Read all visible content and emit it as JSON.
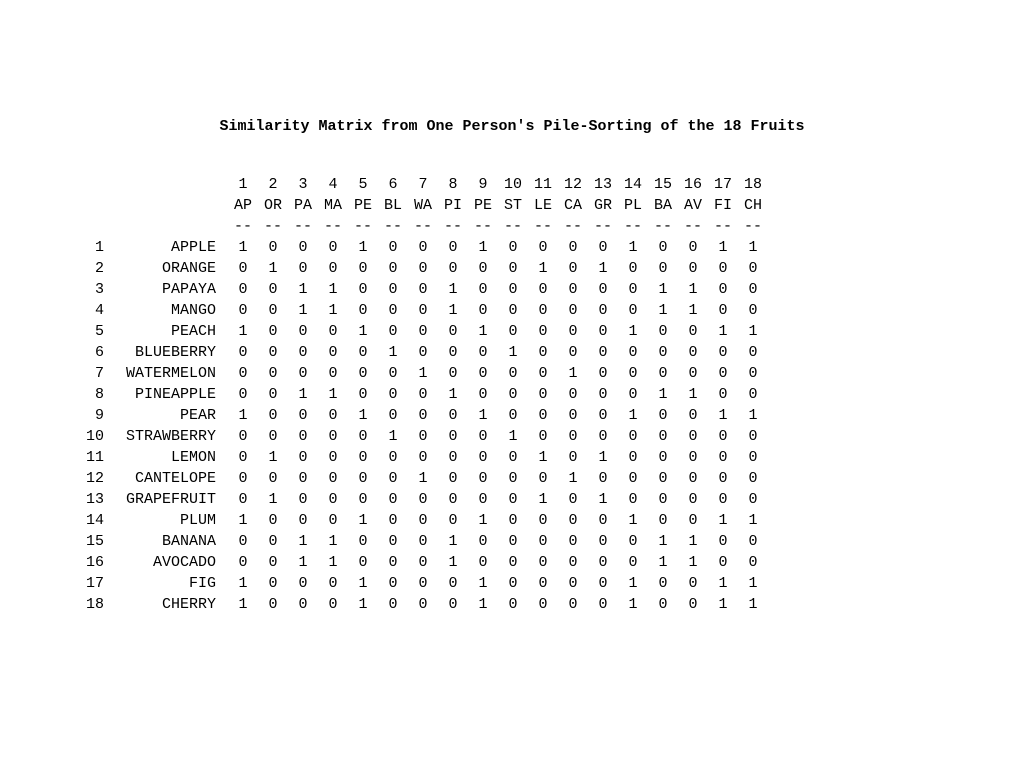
{
  "title": "Similarity Matrix from One Person's Pile-Sorting of the 18 Fruits",
  "col_numbers": [
    "1",
    "2",
    "3",
    "4",
    "5",
    "6",
    "7",
    "8",
    "9",
    "10",
    "11",
    "12",
    "13",
    "14",
    "15",
    "16",
    "17",
    "18"
  ],
  "col_abbrs": [
    "AP",
    "OR",
    "PA",
    "MA",
    "PE",
    "BL",
    "WA",
    "PI",
    "PE",
    "ST",
    "LE",
    "CA",
    "GR",
    "PL",
    "BA",
    "AV",
    "FI",
    "CH"
  ],
  "dash": "--",
  "rows": [
    {
      "idx": "1",
      "name": "APPLE",
      "v": [
        "1",
        "0",
        "0",
        "0",
        "1",
        "0",
        "0",
        "0",
        "1",
        "0",
        "0",
        "0",
        "0",
        "1",
        "0",
        "0",
        "1",
        "1"
      ]
    },
    {
      "idx": "2",
      "name": "ORANGE",
      "v": [
        "0",
        "1",
        "0",
        "0",
        "0",
        "0",
        "0",
        "0",
        "0",
        "0",
        "1",
        "0",
        "1",
        "0",
        "0",
        "0",
        "0",
        "0"
      ]
    },
    {
      "idx": "3",
      "name": "PAPAYA",
      "v": [
        "0",
        "0",
        "1",
        "1",
        "0",
        "0",
        "0",
        "1",
        "0",
        "0",
        "0",
        "0",
        "0",
        "0",
        "1",
        "1",
        "0",
        "0"
      ]
    },
    {
      "idx": "4",
      "name": "MANGO",
      "v": [
        "0",
        "0",
        "1",
        "1",
        "0",
        "0",
        "0",
        "1",
        "0",
        "0",
        "0",
        "0",
        "0",
        "0",
        "1",
        "1",
        "0",
        "0"
      ]
    },
    {
      "idx": "5",
      "name": "PEACH",
      "v": [
        "1",
        "0",
        "0",
        "0",
        "1",
        "0",
        "0",
        "0",
        "1",
        "0",
        "0",
        "0",
        "0",
        "1",
        "0",
        "0",
        "1",
        "1"
      ]
    },
    {
      "idx": "6",
      "name": "BLUEBERRY",
      "v": [
        "0",
        "0",
        "0",
        "0",
        "0",
        "1",
        "0",
        "0",
        "0",
        "1",
        "0",
        "0",
        "0",
        "0",
        "0",
        "0",
        "0",
        "0"
      ]
    },
    {
      "idx": "7",
      "name": "WATERMELON",
      "v": [
        "0",
        "0",
        "0",
        "0",
        "0",
        "0",
        "1",
        "0",
        "0",
        "0",
        "0",
        "1",
        "0",
        "0",
        "0",
        "0",
        "0",
        "0"
      ]
    },
    {
      "idx": "8",
      "name": "PINEAPPLE",
      "v": [
        "0",
        "0",
        "1",
        "1",
        "0",
        "0",
        "0",
        "1",
        "0",
        "0",
        "0",
        "0",
        "0",
        "0",
        "1",
        "1",
        "0",
        "0"
      ]
    },
    {
      "idx": "9",
      "name": "PEAR",
      "v": [
        "1",
        "0",
        "0",
        "0",
        "1",
        "0",
        "0",
        "0",
        "1",
        "0",
        "0",
        "0",
        "0",
        "1",
        "0",
        "0",
        "1",
        "1"
      ]
    },
    {
      "idx": "10",
      "name": "STRAWBERRY",
      "v": [
        "0",
        "0",
        "0",
        "0",
        "0",
        "1",
        "0",
        "0",
        "0",
        "1",
        "0",
        "0",
        "0",
        "0",
        "0",
        "0",
        "0",
        "0"
      ]
    },
    {
      "idx": "11",
      "name": "LEMON",
      "v": [
        "0",
        "1",
        "0",
        "0",
        "0",
        "0",
        "0",
        "0",
        "0",
        "0",
        "1",
        "0",
        "1",
        "0",
        "0",
        "0",
        "0",
        "0"
      ]
    },
    {
      "idx": "12",
      "name": "CANTELOPE",
      "v": [
        "0",
        "0",
        "0",
        "0",
        "0",
        "0",
        "1",
        "0",
        "0",
        "0",
        "0",
        "1",
        "0",
        "0",
        "0",
        "0",
        "0",
        "0"
      ]
    },
    {
      "idx": "13",
      "name": "GRAPEFRUIT",
      "v": [
        "0",
        "1",
        "0",
        "0",
        "0",
        "0",
        "0",
        "0",
        "0",
        "0",
        "1",
        "0",
        "1",
        "0",
        "0",
        "0",
        "0",
        "0"
      ]
    },
    {
      "idx": "14",
      "name": "PLUM",
      "v": [
        "1",
        "0",
        "0",
        "0",
        "1",
        "0",
        "0",
        "0",
        "1",
        "0",
        "0",
        "0",
        "0",
        "1",
        "0",
        "0",
        "1",
        "1"
      ]
    },
    {
      "idx": "15",
      "name": "BANANA",
      "v": [
        "0",
        "0",
        "1",
        "1",
        "0",
        "0",
        "0",
        "1",
        "0",
        "0",
        "0",
        "0",
        "0",
        "0",
        "1",
        "1",
        "0",
        "0"
      ]
    },
    {
      "idx": "16",
      "name": "AVOCADO",
      "v": [
        "0",
        "0",
        "1",
        "1",
        "0",
        "0",
        "0",
        "1",
        "0",
        "0",
        "0",
        "0",
        "0",
        "0",
        "1",
        "1",
        "0",
        "0"
      ]
    },
    {
      "idx": "17",
      "name": "FIG",
      "v": [
        "1",
        "0",
        "0",
        "0",
        "1",
        "0",
        "0",
        "0",
        "1",
        "0",
        "0",
        "0",
        "0",
        "1",
        "0",
        "0",
        "1",
        "1"
      ]
    },
    {
      "idx": "18",
      "name": "CHERRY",
      "v": [
        "1",
        "0",
        "0",
        "0",
        "1",
        "0",
        "0",
        "0",
        "1",
        "0",
        "0",
        "0",
        "0",
        "1",
        "0",
        "0",
        "1",
        "1"
      ]
    }
  ],
  "chart_data": {
    "type": "table",
    "title": "Similarity Matrix from One Person's Pile-Sorting of the 18 Fruits",
    "row_labels": [
      "APPLE",
      "ORANGE",
      "PAPAYA",
      "MANGO",
      "PEACH",
      "BLUEBERRY",
      "WATERMELON",
      "PINEAPPLE",
      "PEAR",
      "STRAWBERRY",
      "LEMON",
      "CANTELOPE",
      "GRAPEFRUIT",
      "PLUM",
      "BANANA",
      "AVOCADO",
      "FIG",
      "CHERRY"
    ],
    "col_labels": [
      "AP",
      "OR",
      "PA",
      "MA",
      "PE",
      "BL",
      "WA",
      "PI",
      "PE",
      "ST",
      "LE",
      "CA",
      "GR",
      "PL",
      "BA",
      "AV",
      "FI",
      "CH"
    ],
    "matrix": [
      [
        1,
        0,
        0,
        0,
        1,
        0,
        0,
        0,
        1,
        0,
        0,
        0,
        0,
        1,
        0,
        0,
        1,
        1
      ],
      [
        0,
        1,
        0,
        0,
        0,
        0,
        0,
        0,
        0,
        0,
        1,
        0,
        1,
        0,
        0,
        0,
        0,
        0
      ],
      [
        0,
        0,
        1,
        1,
        0,
        0,
        0,
        1,
        0,
        0,
        0,
        0,
        0,
        0,
        1,
        1,
        0,
        0
      ],
      [
        0,
        0,
        1,
        1,
        0,
        0,
        0,
        1,
        0,
        0,
        0,
        0,
        0,
        0,
        1,
        1,
        0,
        0
      ],
      [
        1,
        0,
        0,
        0,
        1,
        0,
        0,
        0,
        1,
        0,
        0,
        0,
        0,
        1,
        0,
        0,
        1,
        1
      ],
      [
        0,
        0,
        0,
        0,
        0,
        1,
        0,
        0,
        0,
        1,
        0,
        0,
        0,
        0,
        0,
        0,
        0,
        0
      ],
      [
        0,
        0,
        0,
        0,
        0,
        0,
        1,
        0,
        0,
        0,
        0,
        1,
        0,
        0,
        0,
        0,
        0,
        0
      ],
      [
        0,
        0,
        1,
        1,
        0,
        0,
        0,
        1,
        0,
        0,
        0,
        0,
        0,
        0,
        1,
        1,
        0,
        0
      ],
      [
        1,
        0,
        0,
        0,
        1,
        0,
        0,
        0,
        1,
        0,
        0,
        0,
        0,
        1,
        0,
        0,
        1,
        1
      ],
      [
        0,
        0,
        0,
        0,
        0,
        1,
        0,
        0,
        0,
        1,
        0,
        0,
        0,
        0,
        0,
        0,
        0,
        0
      ],
      [
        0,
        1,
        0,
        0,
        0,
        0,
        0,
        0,
        0,
        0,
        1,
        0,
        1,
        0,
        0,
        0,
        0,
        0
      ],
      [
        0,
        0,
        0,
        0,
        0,
        0,
        1,
        0,
        0,
        0,
        0,
        1,
        0,
        0,
        0,
        0,
        0,
        0
      ],
      [
        0,
        1,
        0,
        0,
        0,
        0,
        0,
        0,
        0,
        0,
        1,
        0,
        1,
        0,
        0,
        0,
        0,
        0
      ],
      [
        1,
        0,
        0,
        0,
        1,
        0,
        0,
        0,
        1,
        0,
        0,
        0,
        0,
        1,
        0,
        0,
        1,
        1
      ],
      [
        0,
        0,
        1,
        1,
        0,
        0,
        0,
        1,
        0,
        0,
        0,
        0,
        0,
        0,
        1,
        1,
        0,
        0
      ],
      [
        0,
        0,
        1,
        1,
        0,
        0,
        0,
        1,
        0,
        0,
        0,
        0,
        0,
        0,
        1,
        1,
        0,
        0
      ],
      [
        1,
        0,
        0,
        0,
        1,
        0,
        0,
        0,
        1,
        0,
        0,
        0,
        0,
        1,
        0,
        0,
        1,
        1
      ],
      [
        1,
        0,
        0,
        0,
        1,
        0,
        0,
        0,
        1,
        0,
        0,
        0,
        0,
        1,
        0,
        0,
        1,
        1
      ]
    ]
  }
}
